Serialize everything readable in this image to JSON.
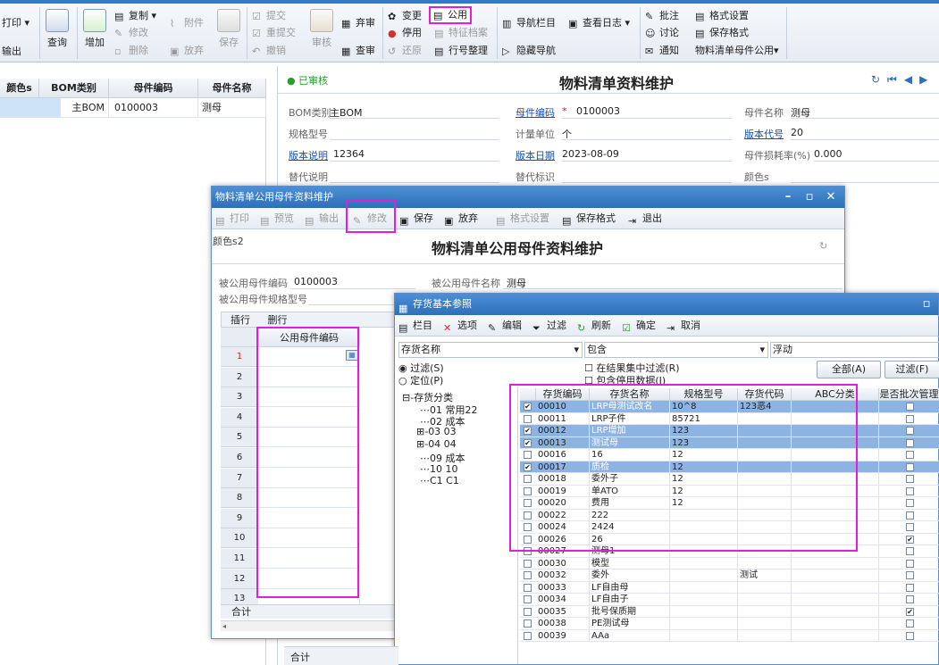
{
  "ribbon": {
    "print": "打印",
    "export": "输出",
    "query": "查询",
    "add": "增加",
    "copy": "复制",
    "modify": "修改",
    "delete": "删除",
    "attach": "附件",
    "discard": "放弃",
    "save": "保存",
    "submit": "提交",
    "resubmit": "重提交",
    "revoke": "撤销",
    "audit": "审核",
    "abandon": "弃审",
    "lookup": "查审",
    "change": "变更",
    "public": "公用",
    "stop": "停用",
    "feature_archive": "特征档案",
    "restore": "还原",
    "line_arrange": "行号整理",
    "nav_column": "导航栏目",
    "view_log": "查看日志",
    "hide_nav": "隐藏导航",
    "comment": "批注",
    "discuss": "讨论",
    "notify": "通知",
    "format_settings": "格式设置",
    "save_format": "保存格式",
    "bom_public": "物料清单母件公用▾"
  },
  "left_grid": {
    "headers": [
      "颜色s",
      "BOM类别",
      "母件编码",
      "母件名称"
    ],
    "row": [
      "",
      "主BOM",
      "0100003",
      "测母"
    ]
  },
  "main_form": {
    "status": "已审核",
    "title": "物料清单资料维护",
    "fields": {
      "bom_type_label": "BOM类别",
      "bom_type_value": "主BOM",
      "parent_code_label": "母件编码",
      "parent_code_value": "0100003",
      "parent_name_label": "母件名称",
      "parent_name_value": "测母",
      "spec_label": "规格型号",
      "unit_label": "计量单位",
      "unit_value": "个",
      "version_code_label": "版本代号",
      "version_code_value": "20",
      "version_desc_label": "版本说明",
      "version_desc_value": "12364",
      "version_date_label": "版本日期",
      "version_date_value": "2023-08-09",
      "loss_rate_label": "母件损耗率(%)",
      "loss_rate_value": "0.000",
      "sub_desc_label": "替代说明",
      "sub_flag_label": "替代标识",
      "color_label": "颜色s"
    },
    "bottom_total": "合计"
  },
  "dialog1": {
    "window_title": "物料清单公用母件资料维护",
    "toolbar": [
      "打印",
      "预览",
      "输出",
      "修改",
      "保存",
      "放弃",
      "格式设置",
      "保存格式",
      "退出"
    ],
    "color_label": "颜色s2",
    "heading": "物料清单公用母件资料维护",
    "shared_code_label": "被公用母件编码",
    "shared_code_value": "0100003",
    "shared_name_label": "被公用母件名称",
    "shared_name_value": "测母",
    "shared_spec_label": "被公用母件规格型号",
    "insert_row": "插行",
    "delete_row": "删行",
    "col_header": "公用母件编码",
    "rows": [
      "1",
      "2",
      "3",
      "4",
      "5",
      "6",
      "7",
      "8",
      "9",
      "10",
      "11",
      "12",
      "13"
    ],
    "total": "合计"
  },
  "dialog2": {
    "window_title": "存货基本参照",
    "toolbar": [
      "栏目",
      "选项",
      "编辑",
      "过滤",
      "刷新",
      "确定",
      "取消"
    ],
    "filter_field": "存货名称",
    "filter_op": "包含",
    "filter_mode": "浮动",
    "radio_filter": "过滤(S)",
    "radio_locate": "定位(P)",
    "chk_in_result": "在结果集中过滤(R)",
    "chk_include_disabled": "包含停用数据(I)",
    "btn_all": "全部(A)",
    "btn_filter": "过滤(F)",
    "tree": [
      "存货分类",
      "01 常用22",
      "02 成本",
      "03 03",
      "04 04",
      "09 成本",
      "10 10",
      "C1 C1"
    ],
    "grid_headers": [
      "存货编码",
      "存货名称",
      "规格型号",
      "存货代码",
      "ABC分类",
      "是否批次管理"
    ],
    "grid_rows": [
      {
        "checked": true,
        "selected": true,
        "code": "00010",
        "name": "LRP母测试改名",
        "spec": "10^8",
        "invcode": "123恶4",
        "batch": false
      },
      {
        "checked": false,
        "selected": false,
        "code": "00011",
        "name": "LRP子件",
        "spec": "85721",
        "invcode": "",
        "batch": false
      },
      {
        "checked": true,
        "selected": true,
        "code": "00012",
        "name": "LRP增加",
        "spec": "123",
        "invcode": "",
        "batch": false
      },
      {
        "checked": true,
        "selected": true,
        "code": "00013",
        "name": "测试母",
        "spec": "123",
        "invcode": "",
        "batch": false
      },
      {
        "checked": false,
        "selected": false,
        "code": "00016",
        "name": "16",
        "spec": "12",
        "invcode": "",
        "batch": false
      },
      {
        "checked": true,
        "selected": true,
        "code": "00017",
        "name": "质检",
        "spec": "12",
        "invcode": "",
        "batch": false
      },
      {
        "checked": false,
        "selected": false,
        "code": "00018",
        "name": "委外子",
        "spec": "12",
        "invcode": "",
        "batch": false
      },
      {
        "checked": false,
        "selected": false,
        "code": "00019",
        "name": "单ATO",
        "spec": "12",
        "invcode": "",
        "batch": false
      },
      {
        "checked": false,
        "selected": false,
        "code": "00020",
        "name": "费用",
        "spec": "12",
        "invcode": "",
        "batch": false
      },
      {
        "checked": false,
        "selected": false,
        "code": "00022",
        "name": "222",
        "spec": "",
        "invcode": "",
        "batch": false
      },
      {
        "checked": false,
        "selected": false,
        "code": "00024",
        "name": "2424",
        "spec": "",
        "invcode": "",
        "batch": false
      },
      {
        "checked": false,
        "selected": false,
        "code": "00026",
        "name": "26",
        "spec": "",
        "invcode": "",
        "batch": true
      },
      {
        "checked": false,
        "selected": false,
        "code": "00027",
        "name": "测母1",
        "spec": "",
        "invcode": "",
        "batch": false
      },
      {
        "checked": false,
        "selected": false,
        "code": "00030",
        "name": "模型",
        "spec": "",
        "invcode": "",
        "batch": false
      },
      {
        "checked": false,
        "selected": false,
        "code": "00032",
        "name": "委外",
        "spec": "",
        "invcode": "测试",
        "batch": false
      },
      {
        "checked": false,
        "selected": false,
        "code": "00033",
        "name": "LF自由母",
        "spec": "",
        "invcode": "",
        "batch": false
      },
      {
        "checked": false,
        "selected": false,
        "code": "00034",
        "name": "LF自由子",
        "spec": "",
        "invcode": "",
        "batch": false
      },
      {
        "checked": false,
        "selected": false,
        "code": "00035",
        "name": "批号保质期",
        "spec": "",
        "invcode": "",
        "batch": true
      },
      {
        "checked": false,
        "selected": false,
        "code": "00038",
        "name": "PE测试母",
        "spec": "",
        "invcode": "",
        "batch": false
      },
      {
        "checked": false,
        "selected": false,
        "code": "00039",
        "name": "AAa",
        "spec": "",
        "invcode": "",
        "batch": false
      }
    ]
  },
  "colors": {
    "accent": "#2d6fb8",
    "highlight": "#e020d8",
    "selected_row": "#8db3e2",
    "link": "#1a4fb3",
    "status_green": "#2a9d2a"
  }
}
